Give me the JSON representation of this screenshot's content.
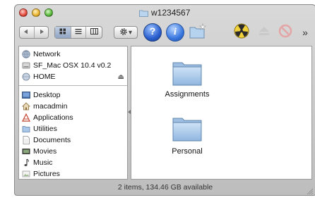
{
  "window": {
    "title": "w1234567"
  },
  "toolbar": {
    "nav": {
      "back_icon": "back-arrow-icon",
      "forward_icon": "forward-arrow-icon"
    },
    "view_modes": [
      {
        "icon": "icon-view-icon",
        "selected": true
      },
      {
        "icon": "list-view-icon",
        "selected": false
      },
      {
        "icon": "column-view-icon",
        "selected": false
      }
    ],
    "action_icon": "gear-icon",
    "action_chevron": "▾",
    "more_chevron": "»"
  },
  "sidebar": {
    "devices": [
      {
        "label": "Network",
        "icon": "globe-icon"
      },
      {
        "label": "SF_Mac OSX 10.4 v0.2",
        "icon": "disk-icon"
      },
      {
        "label": "HOME",
        "icon": "network-volume-icon",
        "eject": "⏏"
      }
    ],
    "places": [
      {
        "label": "Desktop",
        "icon": "desktop-icon"
      },
      {
        "label": "macadmin",
        "icon": "home-icon"
      },
      {
        "label": "Applications",
        "icon": "applications-icon"
      },
      {
        "label": "Utilities",
        "icon": "utilities-icon"
      },
      {
        "label": "Documents",
        "icon": "documents-icon"
      },
      {
        "label": "Movies",
        "icon": "movies-icon"
      },
      {
        "label": "Music",
        "icon": "music-icon"
      },
      {
        "label": "Pictures",
        "icon": "pictures-icon"
      }
    ]
  },
  "main": {
    "items": [
      {
        "label": "Assignments",
        "icon": "folder-icon"
      },
      {
        "label": "Personal",
        "icon": "folder-icon"
      }
    ]
  },
  "status": {
    "text": "2 items, 134.46 GB available"
  },
  "colors": {
    "folder_blue": "#9fc6ea",
    "window_gray": "#c9c9c9"
  }
}
